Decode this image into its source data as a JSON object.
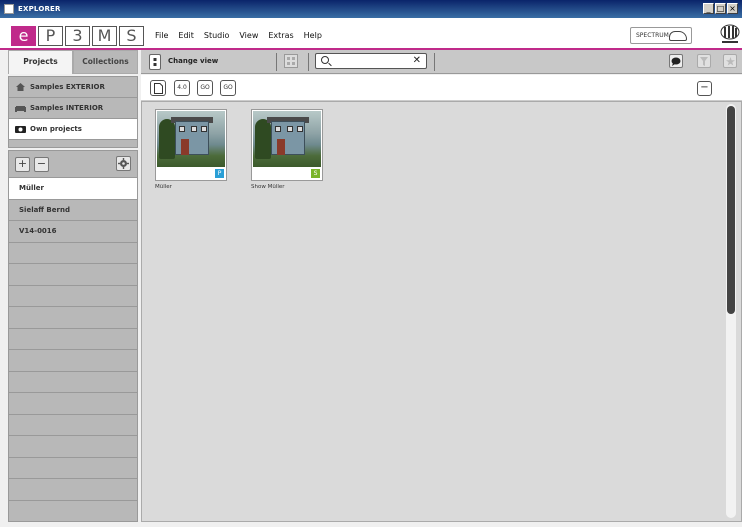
{
  "window": {
    "title": "EXPLORER",
    "controls": [
      "_",
      "□",
      "×"
    ]
  },
  "logo": {
    "letters": [
      "e",
      "P",
      "3",
      "M",
      "S"
    ]
  },
  "menu": {
    "items": [
      "File",
      "Edit",
      "Studio",
      "View",
      "Extras",
      "Help"
    ]
  },
  "brand": {
    "spectrum": "SPECTRUM"
  },
  "tabs": {
    "projects": "Projects",
    "collections": "Collections"
  },
  "samples": {
    "items": [
      "Samples EXTERIOR",
      "Samples INTERIOR",
      "Own projects"
    ]
  },
  "project_tools": {
    "add": "+",
    "remove": "−"
  },
  "projects": {
    "items": [
      "Müller",
      "Sielaff Bernd",
      "V14-0016"
    ]
  },
  "toolbar": {
    "change_view": "Change view",
    "search_value": "",
    "search_clear": "✕"
  },
  "subbar": {
    "new": "",
    "v40": "4.0",
    "go1": "GO",
    "go2": "GO",
    "collapse": "−"
  },
  "thumbnails": [
    {
      "label": "Müller",
      "badge": "P",
      "badge_color": "#2a9fd6"
    },
    {
      "label": "Show Müller",
      "badge": "S",
      "badge_color": "#7ab42a"
    }
  ]
}
